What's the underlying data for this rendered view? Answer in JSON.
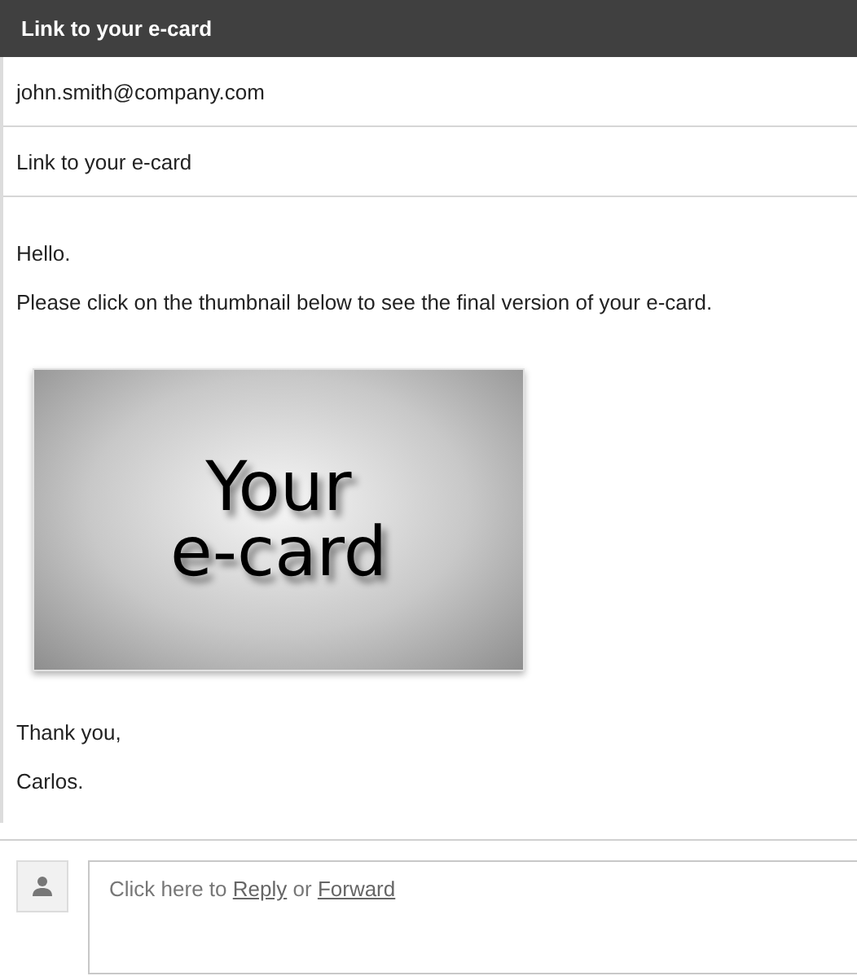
{
  "header": {
    "title": "Link to your e-card"
  },
  "message": {
    "to": "john.smith@company.com",
    "subject": "Link to your e-card",
    "greeting": "Hello.",
    "intro": "Please click on the thumbnail below to see the final version of your e-card.",
    "thumbnail": {
      "lines": [
        "Your",
        "e-card"
      ]
    },
    "closing": "Thank you,",
    "signature": "Carlos."
  },
  "reply": {
    "prefix": "Click here to",
    "reply_link": "Reply",
    "joiner": "or",
    "forward_link": "Forward"
  }
}
